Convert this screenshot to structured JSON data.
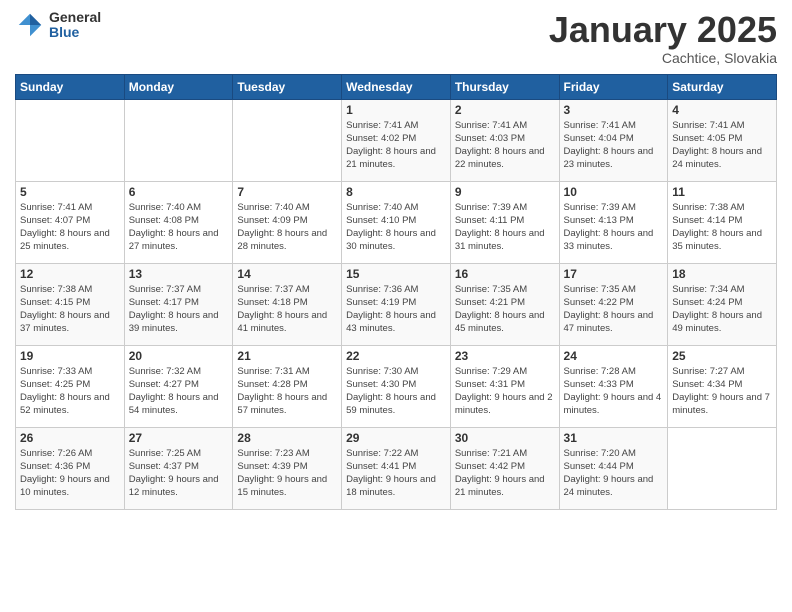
{
  "header": {
    "logo_general": "General",
    "logo_blue": "Blue",
    "month_year": "January 2025",
    "location": "Cachtice, Slovakia"
  },
  "weekdays": [
    "Sunday",
    "Monday",
    "Tuesday",
    "Wednesday",
    "Thursday",
    "Friday",
    "Saturday"
  ],
  "weeks": [
    [
      {
        "day": "",
        "sunrise": "",
        "sunset": "",
        "daylight": ""
      },
      {
        "day": "",
        "sunrise": "",
        "sunset": "",
        "daylight": ""
      },
      {
        "day": "",
        "sunrise": "",
        "sunset": "",
        "daylight": ""
      },
      {
        "day": "1",
        "sunrise": "Sunrise: 7:41 AM",
        "sunset": "Sunset: 4:02 PM",
        "daylight": "Daylight: 8 hours and 21 minutes."
      },
      {
        "day": "2",
        "sunrise": "Sunrise: 7:41 AM",
        "sunset": "Sunset: 4:03 PM",
        "daylight": "Daylight: 8 hours and 22 minutes."
      },
      {
        "day": "3",
        "sunrise": "Sunrise: 7:41 AM",
        "sunset": "Sunset: 4:04 PM",
        "daylight": "Daylight: 8 hours and 23 minutes."
      },
      {
        "day": "4",
        "sunrise": "Sunrise: 7:41 AM",
        "sunset": "Sunset: 4:05 PM",
        "daylight": "Daylight: 8 hours and 24 minutes."
      }
    ],
    [
      {
        "day": "5",
        "sunrise": "Sunrise: 7:41 AM",
        "sunset": "Sunset: 4:07 PM",
        "daylight": "Daylight: 8 hours and 25 minutes."
      },
      {
        "day": "6",
        "sunrise": "Sunrise: 7:40 AM",
        "sunset": "Sunset: 4:08 PM",
        "daylight": "Daylight: 8 hours and 27 minutes."
      },
      {
        "day": "7",
        "sunrise": "Sunrise: 7:40 AM",
        "sunset": "Sunset: 4:09 PM",
        "daylight": "Daylight: 8 hours and 28 minutes."
      },
      {
        "day": "8",
        "sunrise": "Sunrise: 7:40 AM",
        "sunset": "Sunset: 4:10 PM",
        "daylight": "Daylight: 8 hours and 30 minutes."
      },
      {
        "day": "9",
        "sunrise": "Sunrise: 7:39 AM",
        "sunset": "Sunset: 4:11 PM",
        "daylight": "Daylight: 8 hours and 31 minutes."
      },
      {
        "day": "10",
        "sunrise": "Sunrise: 7:39 AM",
        "sunset": "Sunset: 4:13 PM",
        "daylight": "Daylight: 8 hours and 33 minutes."
      },
      {
        "day": "11",
        "sunrise": "Sunrise: 7:38 AM",
        "sunset": "Sunset: 4:14 PM",
        "daylight": "Daylight: 8 hours and 35 minutes."
      }
    ],
    [
      {
        "day": "12",
        "sunrise": "Sunrise: 7:38 AM",
        "sunset": "Sunset: 4:15 PM",
        "daylight": "Daylight: 8 hours and 37 minutes."
      },
      {
        "day": "13",
        "sunrise": "Sunrise: 7:37 AM",
        "sunset": "Sunset: 4:17 PM",
        "daylight": "Daylight: 8 hours and 39 minutes."
      },
      {
        "day": "14",
        "sunrise": "Sunrise: 7:37 AM",
        "sunset": "Sunset: 4:18 PM",
        "daylight": "Daylight: 8 hours and 41 minutes."
      },
      {
        "day": "15",
        "sunrise": "Sunrise: 7:36 AM",
        "sunset": "Sunset: 4:19 PM",
        "daylight": "Daylight: 8 hours and 43 minutes."
      },
      {
        "day": "16",
        "sunrise": "Sunrise: 7:35 AM",
        "sunset": "Sunset: 4:21 PM",
        "daylight": "Daylight: 8 hours and 45 minutes."
      },
      {
        "day": "17",
        "sunrise": "Sunrise: 7:35 AM",
        "sunset": "Sunset: 4:22 PM",
        "daylight": "Daylight: 8 hours and 47 minutes."
      },
      {
        "day": "18",
        "sunrise": "Sunrise: 7:34 AM",
        "sunset": "Sunset: 4:24 PM",
        "daylight": "Daylight: 8 hours and 49 minutes."
      }
    ],
    [
      {
        "day": "19",
        "sunrise": "Sunrise: 7:33 AM",
        "sunset": "Sunset: 4:25 PM",
        "daylight": "Daylight: 8 hours and 52 minutes."
      },
      {
        "day": "20",
        "sunrise": "Sunrise: 7:32 AM",
        "sunset": "Sunset: 4:27 PM",
        "daylight": "Daylight: 8 hours and 54 minutes."
      },
      {
        "day": "21",
        "sunrise": "Sunrise: 7:31 AM",
        "sunset": "Sunset: 4:28 PM",
        "daylight": "Daylight: 8 hours and 57 minutes."
      },
      {
        "day": "22",
        "sunrise": "Sunrise: 7:30 AM",
        "sunset": "Sunset: 4:30 PM",
        "daylight": "Daylight: 8 hours and 59 minutes."
      },
      {
        "day": "23",
        "sunrise": "Sunrise: 7:29 AM",
        "sunset": "Sunset: 4:31 PM",
        "daylight": "Daylight: 9 hours and 2 minutes."
      },
      {
        "day": "24",
        "sunrise": "Sunrise: 7:28 AM",
        "sunset": "Sunset: 4:33 PM",
        "daylight": "Daylight: 9 hours and 4 minutes."
      },
      {
        "day": "25",
        "sunrise": "Sunrise: 7:27 AM",
        "sunset": "Sunset: 4:34 PM",
        "daylight": "Daylight: 9 hours and 7 minutes."
      }
    ],
    [
      {
        "day": "26",
        "sunrise": "Sunrise: 7:26 AM",
        "sunset": "Sunset: 4:36 PM",
        "daylight": "Daylight: 9 hours and 10 minutes."
      },
      {
        "day": "27",
        "sunrise": "Sunrise: 7:25 AM",
        "sunset": "Sunset: 4:37 PM",
        "daylight": "Daylight: 9 hours and 12 minutes."
      },
      {
        "day": "28",
        "sunrise": "Sunrise: 7:23 AM",
        "sunset": "Sunset: 4:39 PM",
        "daylight": "Daylight: 9 hours and 15 minutes."
      },
      {
        "day": "29",
        "sunrise": "Sunrise: 7:22 AM",
        "sunset": "Sunset: 4:41 PM",
        "daylight": "Daylight: 9 hours and 18 minutes."
      },
      {
        "day": "30",
        "sunrise": "Sunrise: 7:21 AM",
        "sunset": "Sunset: 4:42 PM",
        "daylight": "Daylight: 9 hours and 21 minutes."
      },
      {
        "day": "31",
        "sunrise": "Sunrise: 7:20 AM",
        "sunset": "Sunset: 4:44 PM",
        "daylight": "Daylight: 9 hours and 24 minutes."
      },
      {
        "day": "",
        "sunrise": "",
        "sunset": "",
        "daylight": ""
      }
    ]
  ]
}
